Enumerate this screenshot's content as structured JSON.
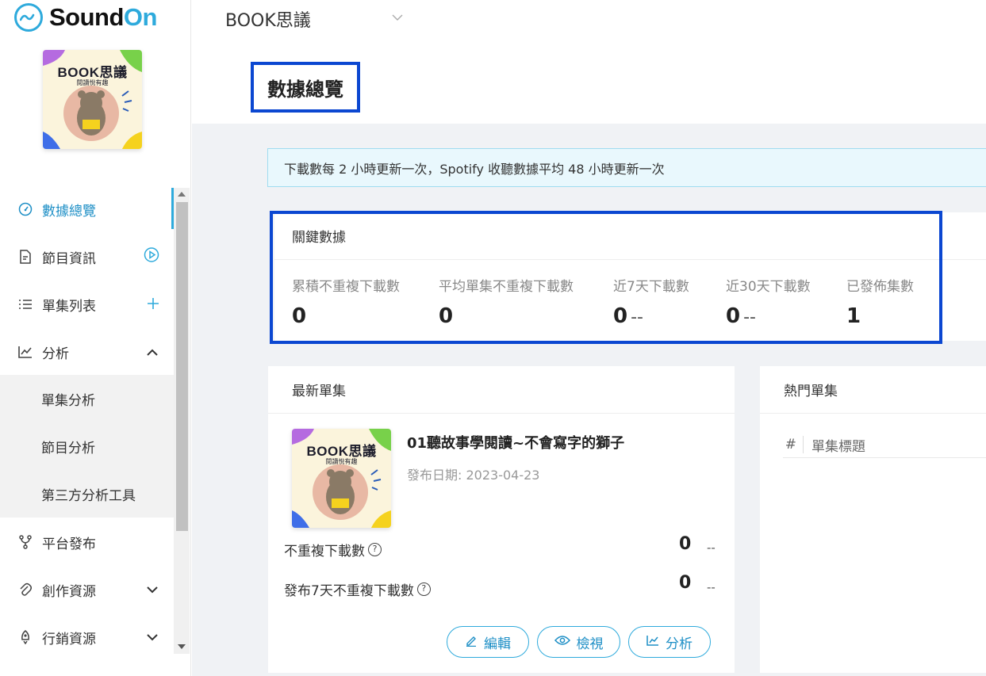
{
  "brand": {
    "name_part1": "Sound",
    "name_part2": "On",
    "accent": "#2eaadc",
    "highlight": "#0b47d1"
  },
  "cover": {
    "title": "BOOK思議",
    "subtitle": "閱讀悅有趣"
  },
  "sidebar": {
    "items": [
      {
        "label": "數據總覽",
        "icon": "dashboard-gauge-icon",
        "active": true
      },
      {
        "label": "節目資訊",
        "icon": "document-icon",
        "trail_icon": "play-circle-icon"
      },
      {
        "label": "單集列表",
        "icon": "list-icon",
        "trail_icon": "plus-icon"
      },
      {
        "label": "分析",
        "icon": "line-chart-icon",
        "expanded": true
      },
      {
        "label": "平台發布",
        "icon": "fork-icon"
      },
      {
        "label": "創作資源",
        "icon": "paperclip-icon"
      },
      {
        "label": "行銷資源",
        "icon": "rocket-icon"
      }
    ],
    "sub_items": [
      {
        "label": "單集分析"
      },
      {
        "label": "節目分析"
      },
      {
        "label": "第三方分析工具"
      }
    ]
  },
  "header": {
    "podcast_name": "BOOK思議",
    "page_title": "數據總覽"
  },
  "notice": "下載數每 2 小時更新一次，Spotify 收聽數據平均 48 小時更新一次",
  "key_metrics": {
    "title": "關鍵數據",
    "items": [
      {
        "label": "累積不重複下載數",
        "value": "0",
        "trend": ""
      },
      {
        "label": "平均單集不重複下載數",
        "value": "0",
        "trend": ""
      },
      {
        "label": "近7天下載數",
        "value": "0",
        "trend": "--"
      },
      {
        "label": "近30天下載數",
        "value": "0",
        "trend": "--"
      },
      {
        "label": "已發佈集數",
        "value": "1",
        "trend": ""
      }
    ]
  },
  "latest_episode": {
    "card_title": "最新單集",
    "title": "01聽故事學閱讀~不會寫字的獅子",
    "date": "發布日期: 2023-04-23",
    "stats": [
      {
        "label": "不重複下載數",
        "value": "0",
        "trend": "--"
      },
      {
        "label": "發布7天不重複下載數",
        "value": "0",
        "trend": "--"
      }
    ],
    "buttons": {
      "edit": "編輯",
      "view": "檢視",
      "analyze": "分析"
    }
  },
  "hot_episodes": {
    "card_title": "熱門單集",
    "col_index": "#",
    "col_title": "單集標題"
  }
}
